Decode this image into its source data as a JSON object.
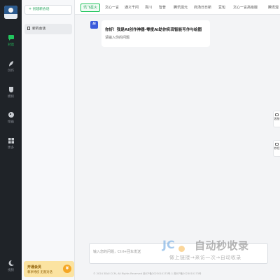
{
  "rail": {
    "items": [
      {
        "label": "对话",
        "icon": "chat-icon",
        "active": true
      },
      {
        "label": "创作",
        "icon": "feather-icon",
        "active": false
      },
      {
        "label": "模拟",
        "icon": "mask-icon",
        "active": false
      },
      {
        "label": "绘画",
        "icon": "palette-icon",
        "active": false
      },
      {
        "label": "更多",
        "icon": "grid-icon",
        "active": false
      }
    ],
    "bottom_label": "视频",
    "accent_color": "#22c55e"
  },
  "panel": {
    "new_button": "+ 创建新会话",
    "session": "新的会话",
    "promo_title": "开通会员",
    "promo_sub": "尊享特权 无限对话",
    "promo_coin": "¥"
  },
  "tabs": [
    "讯飞星火",
    "文心一言",
    "通义千问",
    "百川",
    "智普",
    "腾讯混元",
    "商汤日日新",
    "豆包",
    "文心一言高级版",
    "腾讯混"
  ],
  "chat": {
    "avatar_text": "AI",
    "greeting": "你好！我是AI创作神器-零度AI助你实现智能写作与绘图",
    "sub": "请输入你的问题"
  },
  "float_buttons": [
    "客服",
    "教程"
  ],
  "input": {
    "placeholder": "输入您的问题，Ctrl+回车发送"
  },
  "footer": "© 2024 3DAI CCM, All Rights Reserved 渝ICP备2023010173号-1 湘ICP备2023010173号",
  "watermark": {
    "title": "自动秒收录",
    "sub": "做上链接→来访一次→自动收录"
  }
}
